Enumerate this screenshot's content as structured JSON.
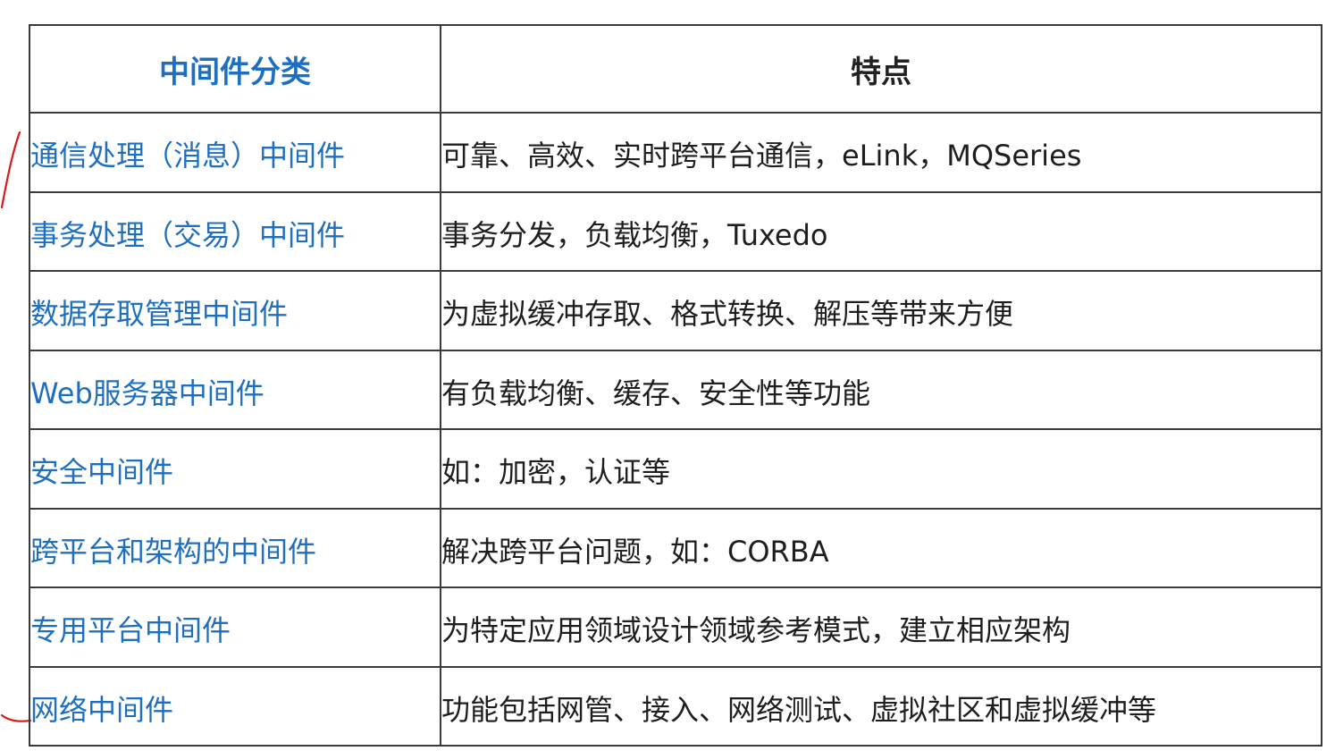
{
  "table": {
    "headers": [
      "中间件分类",
      "特点"
    ],
    "rows": [
      {
        "category": "通信处理（消息）中间件",
        "feature": "可靠、高效、实时跨平台通信，eLink，MQSeries"
      },
      {
        "category": "事务处理（交易）中间件",
        "feature": "事务分发，负载均衡，Tuxedo"
      },
      {
        "category": "数据存取管理中间件",
        "feature": "为虚拟缓冲存取、格式转换、解压等带来方便"
      },
      {
        "category": "Web服务器中间件",
        "feature": "有负载均衡、缓存、安全性等功能"
      },
      {
        "category": "安全中间件",
        "feature": "如：加密，认证等"
      },
      {
        "category": "跨平台和架构的中间件",
        "feature": "解决跨平台问题，如：CORBA"
      },
      {
        "category": "专用平台中间件",
        "feature": "为特定应用领域设计领域参考模式，建立相应架构"
      },
      {
        "category": "网络中间件",
        "feature": "功能包括网管、接入、网络测试、虚拟社区和虚拟缓冲等"
      }
    ]
  },
  "colors": {
    "category_text": "#1f6fc0",
    "annotation_stroke": "#d91a1a",
    "border": "#3a3a3a"
  }
}
